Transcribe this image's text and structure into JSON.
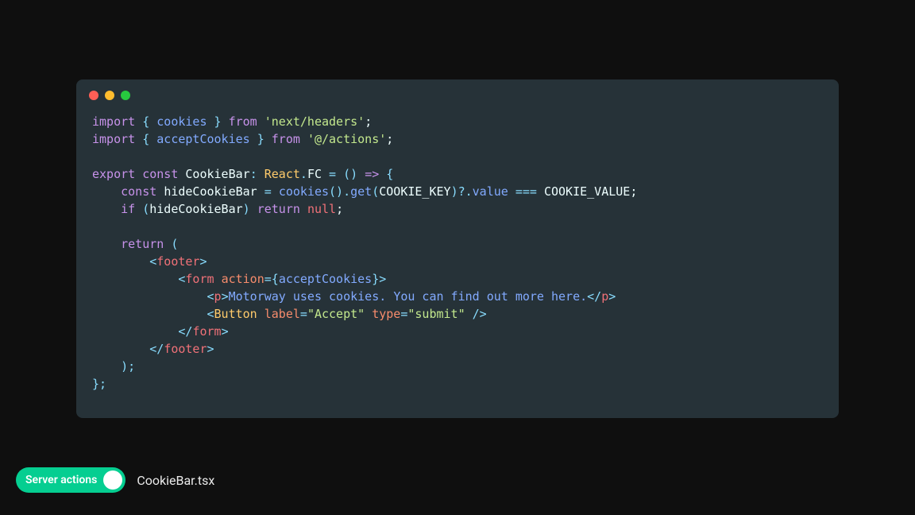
{
  "window": {
    "traffic": [
      "red",
      "yellow",
      "green"
    ]
  },
  "code": {
    "l1": {
      "kw1": "import",
      "br1": "{ ",
      "id1": "cookies",
      "br2": " }",
      "kw2": " from ",
      "str": "'next/headers'",
      "end": ";"
    },
    "l2": {
      "kw1": "import",
      "br1": "{ ",
      "id1": "acceptCookies",
      "br2": " }",
      "kw2": " from ",
      "str": "'@/actions'",
      "end": ";"
    },
    "l4": {
      "kw1": "export",
      "kw2": " const ",
      "id1": "CookieBar",
      "colon": ": ",
      "type": "React",
      "dot": ".",
      "id2": "FC",
      "eq": " = () ",
      "arrow": "=>",
      "brace": " {"
    },
    "l5": {
      "indent": "    ",
      "kw1": "const ",
      "id1": "hideCookieBar ",
      "eq": "= ",
      "fn1": "cookies",
      "call1": "().",
      "fn2": "get",
      "call2": "(",
      "arg1": "COOKIE_KEY",
      "call3": ")?.",
      "fn3": "value",
      "eqeq": " === ",
      "arg2": "COOKIE_VALUE",
      "end": ";"
    },
    "l6": {
      "indent": "    ",
      "kw1": "if ",
      "paren1": "(",
      "id1": "hideCookieBar",
      "paren2": ") ",
      "kw2": "return ",
      "null": "null",
      "end": ";"
    },
    "l8": {
      "indent": "    ",
      "kw1": "return",
      "paren": " ("
    },
    "l9": {
      "indent": "        ",
      "lt": "<",
      "tag": "footer",
      "gt": ">"
    },
    "l10": {
      "indent": "            ",
      "lt": "<",
      "tag": "form",
      "sp": " ",
      "attr": "action",
      "eq": "=",
      "br1": "{",
      "val": "acceptCookies",
      "br2": "}",
      "gt": ">"
    },
    "l11": {
      "indent": "                ",
      "lt": "<",
      "tag": "p",
      "gt": ">",
      "txt1": "Motorway uses cookies. ",
      "txt2": "You can find out more here.",
      "lt2": "</",
      "tag2": "p",
      "gt2": ">"
    },
    "l12": {
      "indent": "                ",
      "lt": "<",
      "tag": "Button",
      "sp": " ",
      "attr1": "label",
      "eq1": "=",
      "val1": "\"Accept\"",
      "sp2": " ",
      "attr2": "type",
      "eq2": "=",
      "val2": "\"submit\"",
      "end": " />"
    },
    "l13": {
      "indent": "            ",
      "lt": "</",
      "tag": "form",
      "gt": ">"
    },
    "l14": {
      "indent": "        ",
      "lt": "</",
      "tag": "footer",
      "gt": ">"
    },
    "l15": {
      "indent": "    ",
      "paren": ");"
    },
    "l16": {
      "brace": "};"
    }
  },
  "footer": {
    "toggle_label": "Server actions",
    "filename": "CookieBar.tsx"
  },
  "colors": {
    "bg": "#0f0f0f",
    "editor_bg": "#263238",
    "toggle_green": "#05ce91"
  }
}
